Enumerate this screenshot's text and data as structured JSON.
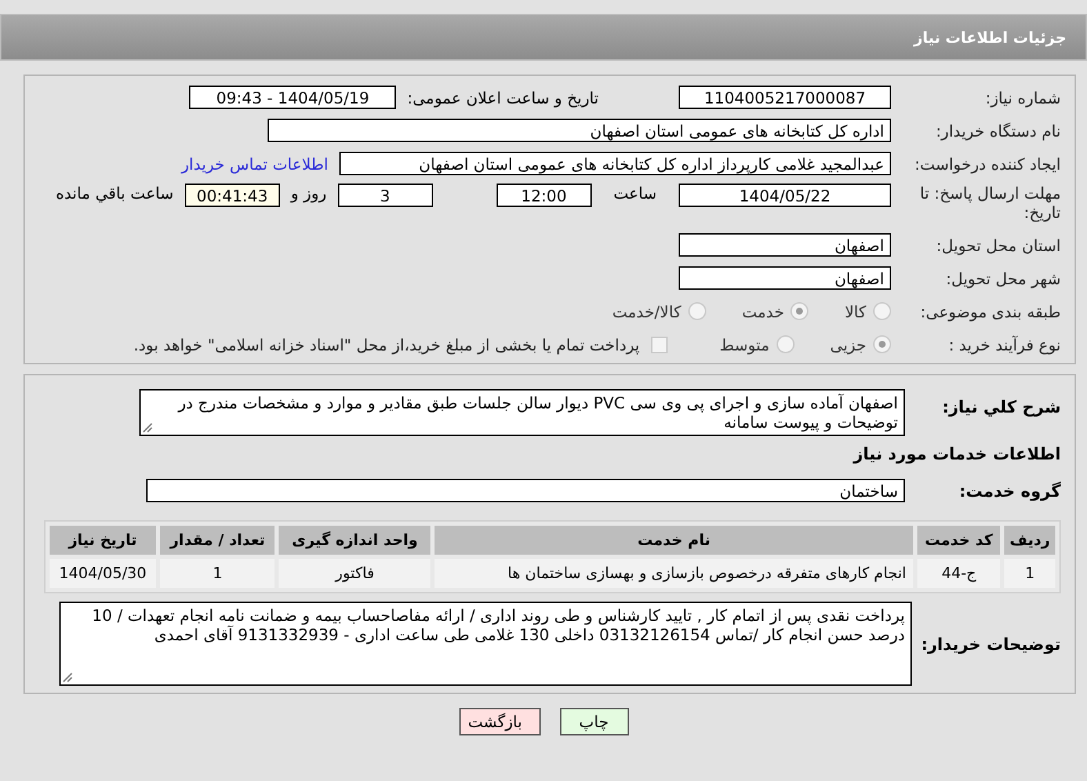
{
  "header": {
    "title": "جزئیات اطلاعات نیاز"
  },
  "need_number": {
    "label": "شماره نیاز:",
    "value": "1104005217000087"
  },
  "announce": {
    "label": "تاریخ و ساعت اعلان عمومی:",
    "value": "1404/05/19 - 09:43"
  },
  "buyer_org": {
    "label": "نام دستگاه خریدار:",
    "value": "اداره کل کتابخانه های عمومی استان اصفهان"
  },
  "requester": {
    "label": "ایجاد کننده درخواست:",
    "value": "عبدالمجید غلامی کارپرداز اداره کل کتابخانه های عمومی استان اصفهان",
    "link": "اطلاعات تماس خریدار"
  },
  "deadline": {
    "label": "مهلت ارسال پاسخ: تا تاریخ:",
    "date": "1404/05/22",
    "time_label": "ساعت",
    "time": "12:00",
    "days": "3",
    "days_label": "روز و",
    "remaining": "00:41:43",
    "remaining_label": "ساعت باقي مانده"
  },
  "province": {
    "label": "استان محل تحویل:",
    "value": "اصفهان"
  },
  "city": {
    "label": "شهر محل تحویل:",
    "value": "اصفهان"
  },
  "category": {
    "label": "طبقه بندی موضوعی:",
    "options": [
      {
        "label": "کالا",
        "selected": false
      },
      {
        "label": "خدمت",
        "selected": true
      },
      {
        "label": "کالا/خدمت",
        "selected": false
      }
    ]
  },
  "process": {
    "label": "نوع فرآیند خرید :",
    "options": [
      {
        "label": "جزیی",
        "selected": true
      },
      {
        "label": "متوسط",
        "selected": false
      }
    ],
    "payment": {
      "checked": false,
      "note": "پرداخت تمام یا بخشی از مبلغ خرید،از محل \"اسناد خزانه اسلامی\" خواهد بود."
    }
  },
  "description": {
    "label": "شرح کلي نیاز:",
    "value": "اصفهان  آماده سازی و اجرای پی وی سی PVC دیوار سالن جلسات طبق مقادیر و موارد و مشخصات مندرج در توضیحات و پیوست سامانه"
  },
  "services_heading": "اطلاعات خدمات مورد نیاز",
  "service_group": {
    "label": "گروه خدمت:",
    "value": "ساختمان"
  },
  "table": {
    "columns": [
      "ردیف",
      "کد خدمت",
      "نام خدمت",
      "واحد اندازه گیری",
      "تعداد / مقدار",
      "تاریخ نیاز"
    ],
    "rows": [
      [
        "1",
        "ج-44",
        "انجام کارهای متفرقه درخصوص بازسازی و بهسازی ساختمان ها",
        "فاکتور",
        "1",
        "1404/05/30"
      ]
    ]
  },
  "buyer_notes": {
    "label": "توضیحات خریدار:",
    "value": "پرداخت نقدی پس از اتمام کار , تایید کارشناس و طی روند اداری / ارائه مفاصاحساب بیمه و ضمانت نامه انجام تعهدات / 10 درصد حسن انجام کار /تماس 03132126154 داخلی 130 غلامی طی ساعت اداری - 9131332939 آقای احمدی"
  },
  "buttons": [
    {
      "label": "چاپ",
      "kind": "print"
    },
    {
      "label": "بازگشت",
      "kind": "back"
    }
  ]
}
